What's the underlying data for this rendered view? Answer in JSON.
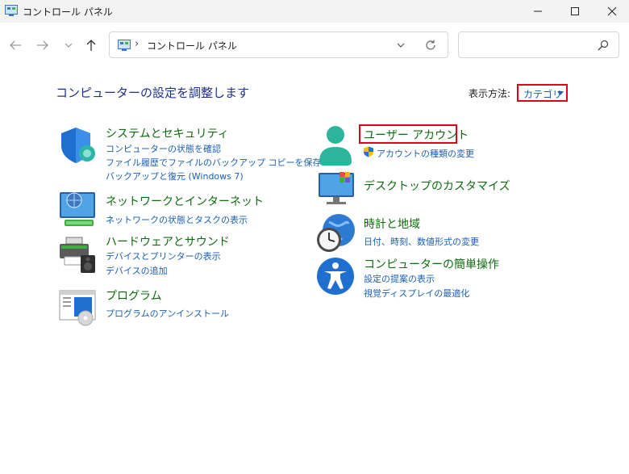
{
  "window": {
    "title": "コントロール パネル"
  },
  "address": {
    "separator": "›",
    "path": "コントロール パネル"
  },
  "search": {
    "placeholder": ""
  },
  "main": {
    "heading": "コンピューターの設定を調整します",
    "view_by_label": "表示方法:",
    "view_by_value": "カテゴリ"
  },
  "categories_left": [
    {
      "title": "システムとセキュリティ",
      "icon": "shield-icon",
      "links": [
        "コンピューターの状態を確認",
        "ファイル履歴でファイルのバックアップ コピーを保存",
        "バックアップと復元 (Windows 7)"
      ]
    },
    {
      "title": "ネットワークとインターネット",
      "icon": "network-icon",
      "links": [
        "ネットワークの状態とタスクの表示"
      ]
    },
    {
      "title": "ハードウェアとサウンド",
      "icon": "printer-icon",
      "links": [
        "デバイスとプリンターの表示",
        "デバイスの追加"
      ]
    },
    {
      "title": "プログラム",
      "icon": "programs-icon",
      "links": [
        "プログラムのアンインストール"
      ]
    }
  ],
  "categories_right": [
    {
      "title": "ユーザー アカウント",
      "icon": "user-icon",
      "links": [
        "アカウントの種類の変更"
      ]
    },
    {
      "title": "デスクトップのカスタマイズ",
      "icon": "desktop-icon",
      "links": []
    },
    {
      "title": "時計と地域",
      "icon": "clock-globe-icon",
      "links": [
        "日付、時刻、数値形式の変更"
      ]
    },
    {
      "title": "コンピューターの簡単操作",
      "icon": "accessibility-icon",
      "links": [
        "設定の提案の表示",
        "視覚ディスプレイの最適化"
      ]
    }
  ],
  "colors": {
    "category_title": "#0e6b0e",
    "link": "#1a5fb4",
    "heading": "#1e3287",
    "highlight": "#e0001a"
  }
}
